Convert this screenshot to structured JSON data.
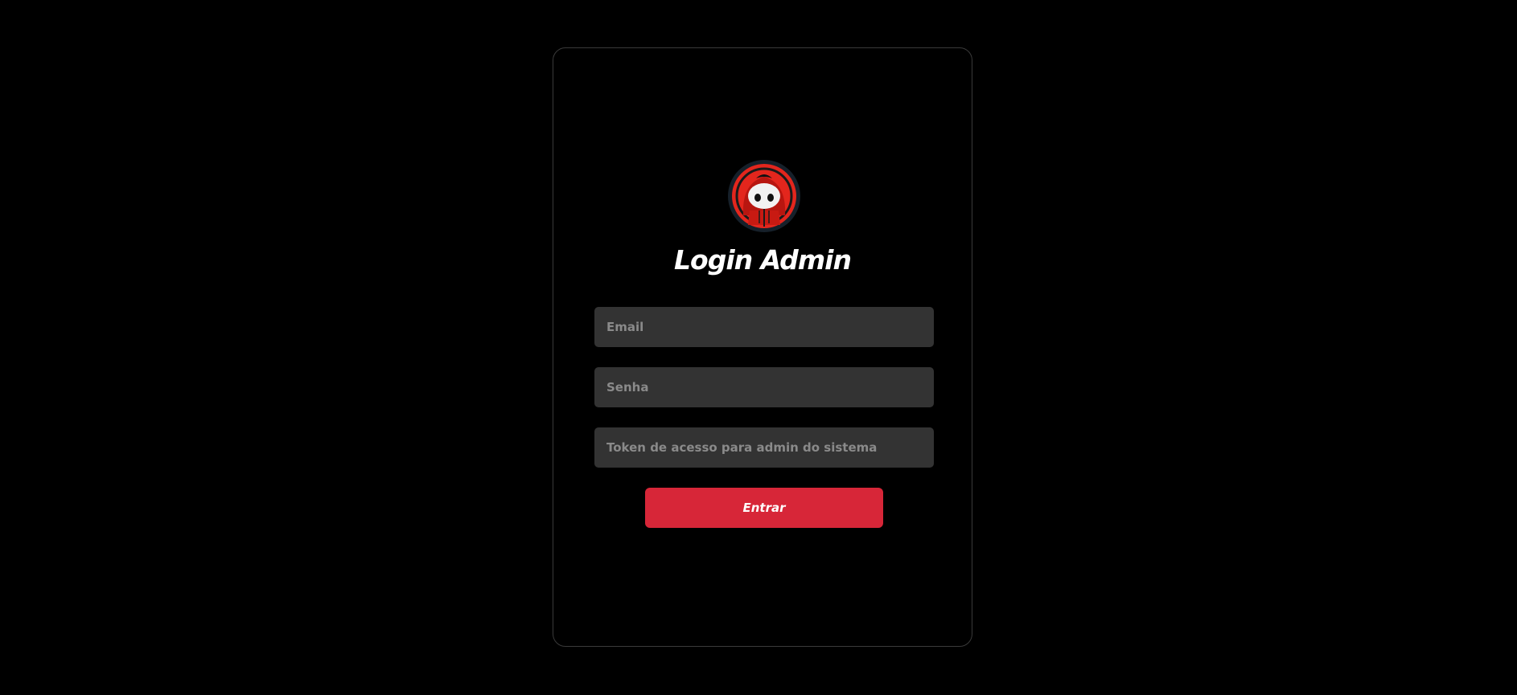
{
  "login": {
    "title": "Login Admin",
    "logo_icon": "hooded-mascot-logo",
    "fields": {
      "email": {
        "placeholder": "Email",
        "value": ""
      },
      "password": {
        "placeholder": "Senha",
        "value": ""
      },
      "token": {
        "placeholder": "Token de acesso para admin do sistema",
        "value": ""
      }
    },
    "submit_label": "Entrar"
  },
  "colors": {
    "background": "#000000",
    "card_border": "#3a3a3a",
    "input_background": "#333333",
    "placeholder": "#8a8a8a",
    "accent": "#d72638",
    "text": "#ffffff"
  }
}
